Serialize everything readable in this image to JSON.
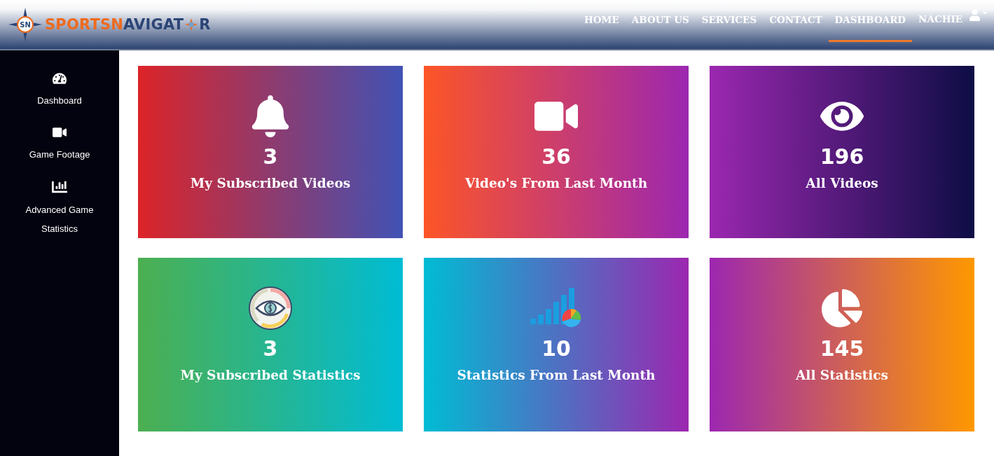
{
  "logo": {
    "part_1": "SPORTS",
    "highlight": "N",
    "part_2": "AVIGAT",
    "part_3": "R",
    "badge": "SN"
  },
  "nav": [
    {
      "label": "HOME",
      "selected": false
    },
    {
      "label": "ABOUT US",
      "selected": false
    },
    {
      "label": "SERVICES",
      "selected": false
    },
    {
      "label": "CONTACT",
      "selected": false
    },
    {
      "label": "DASHBOARD",
      "selected": true
    }
  ],
  "user": {
    "name": "NACHIE"
  },
  "sidebar": {
    "items": [
      {
        "label": "Dashboard",
        "kind": "gauge"
      },
      {
        "label": "Game Footage",
        "kind": "video"
      },
      {
        "label": "Advanced Game Statistics",
        "kind": "bars"
      }
    ]
  },
  "cards": [
    {
      "kind": "bell",
      "count": "3",
      "title": "My Subscribed Videos"
    },
    {
      "kind": "video",
      "count": "36",
      "title": "Video's From Last Month"
    },
    {
      "kind": "eye",
      "count": "196",
      "title": "All Videos"
    },
    {
      "kind": "money-eye",
      "count": "3",
      "title": "My Subscribed Statistics"
    },
    {
      "kind": "chart",
      "count": "10",
      "title": "Statistics From Last Month"
    },
    {
      "kind": "pie",
      "count": "145",
      "title": "All Statistics"
    }
  ]
}
